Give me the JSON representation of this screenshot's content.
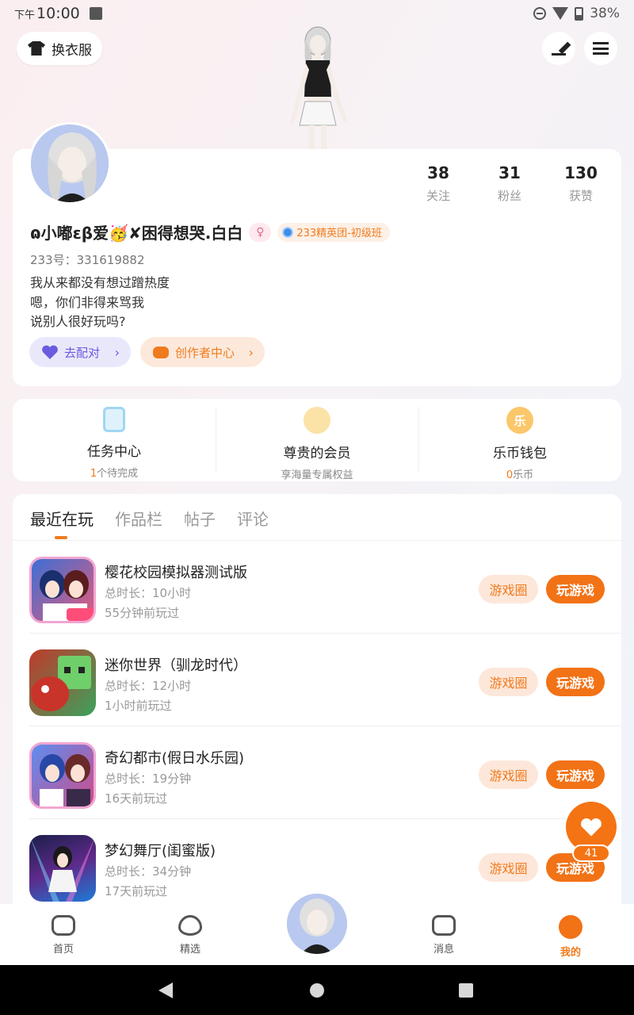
{
  "status_bar": {
    "ampm": "下午",
    "time": "10:00",
    "battery": "38%"
  },
  "top": {
    "outfit_label": "换衣服"
  },
  "profile": {
    "stats": [
      {
        "num": "38",
        "label": "关注"
      },
      {
        "num": "31",
        "label": "粉丝"
      },
      {
        "num": "130",
        "label": "获赞"
      }
    ],
    "nickname": "ɷ小嘟ɛβ爱🥳✘困得想哭.白白",
    "gender_symbol": "♀",
    "badge": "233精英团-初级班",
    "uid": "233号：331619882",
    "bio_lines": [
      "我从来都没有想过蹭热度",
      "嗯，你们非得来骂我",
      "说别人很好玩吗?"
    ],
    "match_label": "去配对",
    "creator_label": "创作者中心",
    "chevron": "›"
  },
  "quick": [
    {
      "title": "任务中心",
      "sub_hl": "1",
      "sub": "个待完成"
    },
    {
      "title": "尊贵的会员",
      "sub_hl": "",
      "sub": "享海量专属权益"
    },
    {
      "title": "乐币钱包",
      "sub_hl": "0",
      "sub": "乐币",
      "icon_char": "乐"
    }
  ],
  "tabs": [
    "最近在玩",
    "作品栏",
    "帖子",
    "评论"
  ],
  "games": [
    {
      "name": "樱花校园模拟器测试版",
      "time": "总时长：10小时",
      "last": "55分钟前玩过"
    },
    {
      "name": "迷你世界（驯龙时代）",
      "time": "总时长：12小时",
      "last": "1小时前玩过"
    },
    {
      "name": "奇幻都市(假日水乐园)",
      "time": "总时长：19分钟",
      "last": "16天前玩过"
    },
    {
      "name": "梦幻舞厅(闺蜜版)",
      "time": "总时长：34分钟",
      "last": "17天前玩过"
    }
  ],
  "game_buttons": {
    "circle": "游戏圈",
    "play": "玩游戏"
  },
  "float": {
    "count": "41"
  },
  "bottom_nav": [
    {
      "label": "首页"
    },
    {
      "label": "精选"
    },
    {
      "label": "消息"
    },
    {
      "label": "我的"
    }
  ],
  "colors": {
    "accent": "#f27216",
    "purple": "#6a5be0"
  }
}
